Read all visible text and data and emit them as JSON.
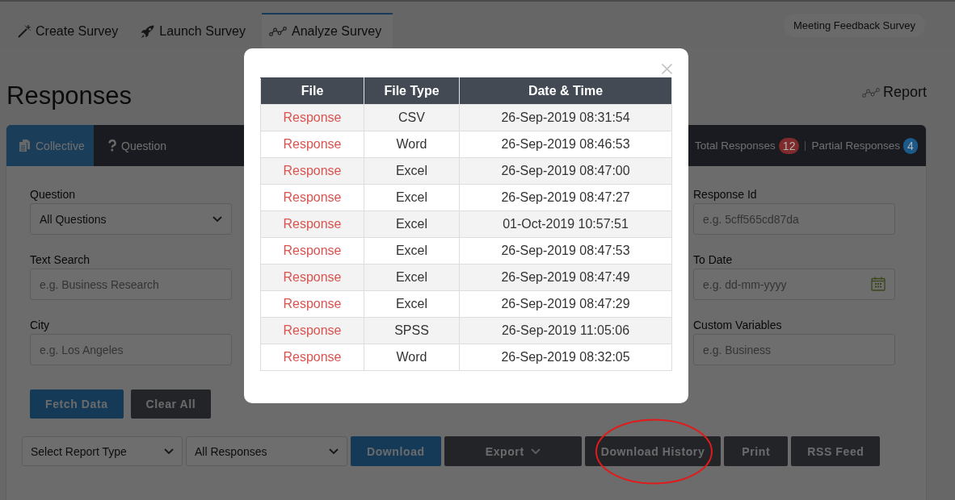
{
  "nav_tabs": [
    {
      "label": "Create Survey",
      "selected": false
    },
    {
      "label": "Launch Survey",
      "selected": false
    },
    {
      "label": "Analyze Survey",
      "selected": true
    }
  ],
  "survey_name": "Meeting Feedback Survey",
  "page_title": "Responses",
  "report_link": "Report",
  "panel": {
    "tabs": [
      {
        "label": "Collective",
        "selected": true
      },
      {
        "label": "Question",
        "selected": false
      }
    ],
    "counters": [
      {
        "label": "Total Responses",
        "count": "12",
        "color": "#7f2b2b"
      },
      {
        "label": "Partial Responses",
        "count": "4",
        "color": "#1b5a8a"
      }
    ]
  },
  "filters": {
    "left": [
      {
        "label": "Question",
        "kind": "select",
        "value": "All Questions"
      },
      {
        "label": "Text Search",
        "kind": "text",
        "placeholder": "e.g. Business Research"
      },
      {
        "label": "City",
        "kind": "text",
        "placeholder": "e.g. Los Angeles"
      }
    ],
    "right": [
      {
        "label": "Response Id",
        "kind": "text",
        "placeholder": "e.g. 5cff565cd87da"
      },
      {
        "label": "To Date",
        "kind": "date",
        "placeholder": "e.g. dd-mm-yyyy"
      },
      {
        "label": "Custom Variables",
        "kind": "text",
        "placeholder": "e.g. Business"
      }
    ]
  },
  "filter_buttons": [
    {
      "label": "Fetch Data",
      "kind": "primary"
    },
    {
      "label": "Clear All",
      "kind": "dark"
    }
  ],
  "toolbar": [
    {
      "kind": "select",
      "value": "Select Report Type",
      "highlighted": false
    },
    {
      "kind": "select",
      "value": "All Responses",
      "highlighted": false
    },
    {
      "kind": "primary",
      "label": "Download",
      "highlighted": false
    },
    {
      "kind": "dropdown",
      "label": "Export",
      "highlighted": false
    },
    {
      "kind": "dark",
      "label": "Download History",
      "highlighted": true
    },
    {
      "kind": "dark",
      "label": "Print",
      "highlighted": false
    },
    {
      "kind": "dark",
      "label": "RSS Feed",
      "highlighted": false
    }
  ],
  "download_history": {
    "columns": [
      "File",
      "File Type",
      "Date & Time"
    ],
    "rows": [
      {
        "file": "Response",
        "file_type": "CSV",
        "date_time": "26-Sep-2019 08:31:54"
      },
      {
        "file": "Response",
        "file_type": "Word",
        "date_time": "26-Sep-2019 08:46:53"
      },
      {
        "file": "Response",
        "file_type": "Excel",
        "date_time": "26-Sep-2019 08:47:00"
      },
      {
        "file": "Response",
        "file_type": "Excel",
        "date_time": "26-Sep-2019 08:47:27"
      },
      {
        "file": "Response",
        "file_type": "Excel",
        "date_time": "01-Oct-2019 10:57:51"
      },
      {
        "file": "Response",
        "file_type": "Excel",
        "date_time": "26-Sep-2019 08:47:53"
      },
      {
        "file": "Response",
        "file_type": "Excel",
        "date_time": "26-Sep-2019 08:47:49"
      },
      {
        "file": "Response",
        "file_type": "Excel",
        "date_time": "26-Sep-2019 08:47:29"
      },
      {
        "file": "Response",
        "file_type": "SPSS",
        "date_time": "26-Sep-2019 11:05:06"
      },
      {
        "file": "Response",
        "file_type": "Word",
        "date_time": "26-Sep-2019 08:32:05"
      }
    ]
  }
}
